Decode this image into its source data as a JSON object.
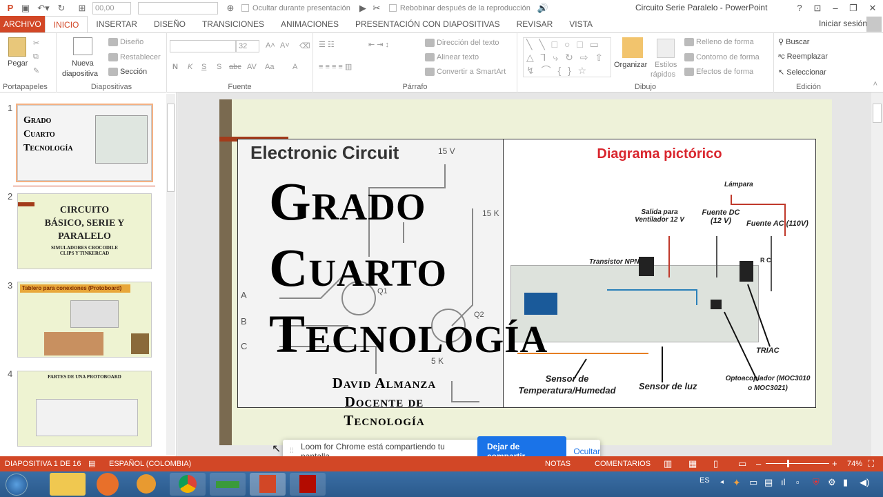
{
  "qat": {
    "font_size": "00,00",
    "hide_label": "Ocultar durante presentación",
    "rewind_label": "Rebobinar después de la reproducción"
  },
  "window": {
    "title": "Circuito Serie Paralelo - PowerPoint",
    "help": "?"
  },
  "tabs": [
    "ARCHIVO",
    "INICIO",
    "INSERTAR",
    "DISEÑO",
    "TRANSICIONES",
    "ANIMACIONES",
    "PRESENTACIÓN CON DIAPOSITIVAS",
    "REVISAR",
    "VISTA"
  ],
  "active_tab": "INICIO",
  "signin": "Iniciar sesión",
  "ribbon": {
    "clipboard": {
      "paste": "Pegar",
      "label": "Portapapeles"
    },
    "slides": {
      "new_slide_1": "Nueva",
      "new_slide_2": "diapositiva",
      "layout": "Diseño",
      "reset": "Restablecer",
      "section": "Sección",
      "label": "Diapositivas"
    },
    "font": {
      "size": "32",
      "bold": "N",
      "italic": "K",
      "underline": "S",
      "shadow": "S",
      "strike": "abc",
      "spacing": "AV",
      "case": "Aa",
      "color": "A",
      "label": "Fuente"
    },
    "paragraph": {
      "direction": "Dirección del texto",
      "align": "Alinear texto",
      "smartart": "Convertir a SmartArt",
      "label": "Párrafo"
    },
    "drawing": {
      "arrange": "Organizar",
      "styles_1": "Estilos",
      "styles_2": "rápidos",
      "fill": "Relleno de forma",
      "outline": "Contorno de forma",
      "effects": "Efectos de forma",
      "label": "Dibujo"
    },
    "editing": {
      "find": "Buscar",
      "replace": "Reemplazar",
      "select": "Seleccionar",
      "label": "Edición"
    }
  },
  "thumbnails": [
    {
      "num": "1",
      "lines": [
        "Grado",
        "Cuarto",
        "Tecnología"
      ]
    },
    {
      "num": "2",
      "lines": [
        "CIRCUITO",
        "BÁSICO, SERIE Y",
        "PARALELO"
      ],
      "sub": "SIMULADORES CROCODILE CLIPS Y TINKERCAD"
    },
    {
      "num": "3",
      "lines": [
        "Tablero para conexiones (Protoboard)"
      ]
    },
    {
      "num": "4",
      "lines": [
        "PARTES DE UNA PROTOBOARD"
      ]
    }
  ],
  "slide": {
    "left_heading": "Electronic Circuit",
    "right_heading": "Diagrama pictórico",
    "title_lines": [
      "Grado",
      "Cuarto",
      "Tecnología"
    ],
    "author_lines": [
      "David Almanza",
      "Docente de",
      "Tecnología"
    ],
    "circuit_labels": {
      "v": "15 V",
      "r1": "15 K",
      "r2": "5 K",
      "q1": "Q1",
      "q2": "Q2",
      "a": "A",
      "b": "B",
      "c": "C"
    },
    "diagram_labels": {
      "lamp": "Lámpara",
      "fan": "Salida para Ventilador 12 V",
      "dc": "Fuente DC (12 V)",
      "ac": "Fuente AC (110V)",
      "npn": "Transistor NPN",
      "triac": "TRIAC",
      "sensor_t": "Sensor de Temperatura/Humedad",
      "sensor_l": "Sensor de luz",
      "opto": "Optoacoplador (MOC3010 o MOC3021)",
      "rc": "R C"
    }
  },
  "status": {
    "slide": "DIAPOSITIVA 1 DE 16",
    "lang": "ESPAÑOL (COLOMBIA)",
    "notes": "NOTAS",
    "comments": "COMENTARIOS",
    "zoom": "74%"
  },
  "loom": {
    "message": "Loom for Chrome está compartiendo tu pantalla.",
    "stop": "Dejar de compartir",
    "hide": "Ocultar"
  },
  "tray": {
    "lang": "ES"
  },
  "colors": {
    "accent": "#d24726",
    "slide_bg": "#eef2d9",
    "loom_btn": "#1a73e8"
  }
}
